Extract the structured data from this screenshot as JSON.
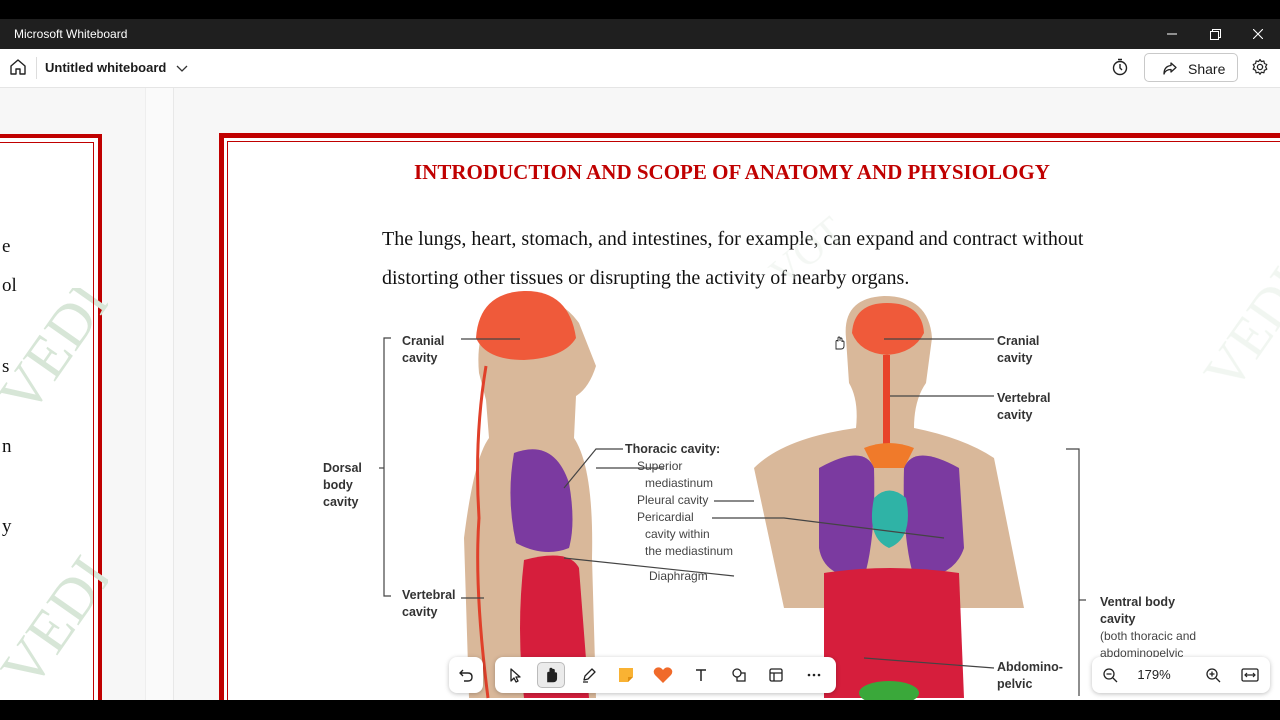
{
  "app": {
    "title": "Microsoft Whiteboard"
  },
  "toolbar": {
    "board_title": "Untitled whiteboard",
    "share_label": "Share"
  },
  "left_page": {
    "fragments": [
      "e",
      "ol",
      "s",
      "n",
      "y"
    ]
  },
  "document": {
    "heading": "INTRODUCTION AND SCOPE OF ANATOMY AND PHYSIOLOGY",
    "paragraph_lines": [
      "The lungs, heart, stomach, and intestines, for example, can expand and contract without",
      "distorting other tissues or disrupting the activity of nearby organs."
    ],
    "figure_labels": {
      "cranial_left": [
        "Cranial",
        "cavity"
      ],
      "dorsal": [
        "Dorsal",
        "body",
        "cavity"
      ],
      "vertebral_left": [
        "Vertebral",
        "cavity"
      ],
      "thoracic": "Thoracic cavity:",
      "superior": [
        "Superior",
        "mediastinum"
      ],
      "pleural": "Pleural cavity",
      "pericardial": [
        "Pericardial",
        "cavity within",
        "the mediastinum"
      ],
      "diaphragm": "Diaphragm",
      "cranial_right": [
        "Cranial",
        "cavity"
      ],
      "vertebral_right": [
        "Vertebral",
        "cavity"
      ],
      "ventral": [
        "Ventral body",
        "cavity"
      ],
      "ventral_note": [
        "(both thoracic and",
        "abdominopelvic"
      ],
      "abdomino": [
        "Abdomino-",
        "pelvic"
      ]
    }
  },
  "zoom": {
    "level": "179%"
  },
  "colors": {
    "accent_red": "#c00000",
    "titlebar": "#1f1f1f"
  }
}
